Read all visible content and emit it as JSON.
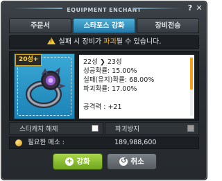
{
  "window": {
    "title": "EQUIPMENT ENCHANT"
  },
  "tabs": [
    {
      "label": "주문서"
    },
    {
      "label": "스타포스 강화"
    },
    {
      "label": "장비전승"
    }
  ],
  "warning": {
    "prefix": "실패 시 장비가 ",
    "highlight": "파괴",
    "suffix": "될 수 있습니다."
  },
  "item": {
    "star_badge": "20성+"
  },
  "stats": {
    "star_from": "22성",
    "star_to": "23성",
    "success_rate": "성공확률: 15.00%",
    "fail_rate": "실패(유지)확률: 68.00%",
    "destroy_rate": "파괴확률: 17.00%",
    "attack": "공격력 : +21"
  },
  "options": {
    "starcatch_label": "스타캐치 해제",
    "prevent_destroy_label": "파괴방지"
  },
  "meso": {
    "label": "필요한 메소 :",
    "value": "189,988,600"
  },
  "buttons": {
    "enhance_label": "강화",
    "cancel_label": "취소"
  },
  "colors": {
    "active_tab": "#2f9ccc",
    "highlight": "#ffb400",
    "enhance_button": "#8cc13a"
  }
}
